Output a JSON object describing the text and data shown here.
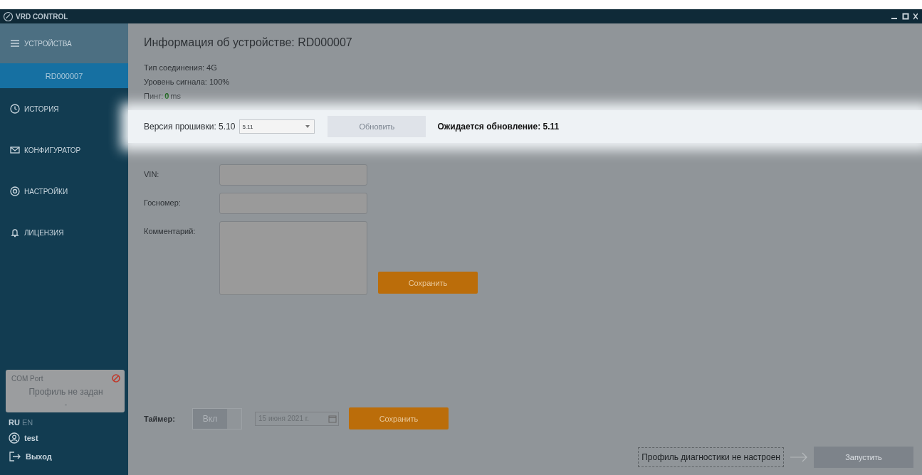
{
  "window": {
    "title": "VRD CONTROL"
  },
  "sidebar": {
    "items": [
      {
        "label": "УСТРОЙСТВА",
        "selected": false,
        "expanded": true,
        "children": [
          {
            "label": "RD000007",
            "selected": true
          }
        ]
      },
      {
        "label": "ИСТОРИЯ",
        "selected": false
      },
      {
        "label": "КОНФИГУРАТОР",
        "selected": false
      },
      {
        "label": "НАСТРОЙКИ",
        "selected": false
      },
      {
        "label": "ЛИЦЕНЗИЯ",
        "selected": false
      }
    ],
    "com_port": {
      "title": "COM Port",
      "profile": "Профиль не задан",
      "value": "-"
    },
    "languages": [
      {
        "label": "RU",
        "selected": true
      },
      {
        "label": "EN",
        "selected": false
      }
    ],
    "user": "test",
    "logout": "Выход"
  },
  "device": {
    "title": "Информация об устройстве: RD000007",
    "info": [
      "Тип соединения: 4G",
      "Уровень сигнала: 100%"
    ],
    "ping": {
      "label": "Пинг:",
      "value": "0",
      "unit": "ms"
    },
    "firmware": {
      "label": "Версия прошивки: 5.10",
      "select": "5.11",
      "button": {
        "label": "Обновить",
        "disabled": true
      },
      "status": "Ожидается обновление: 5.11"
    },
    "fields": [
      {
        "label": "VIN:",
        "kind": "input"
      },
      {
        "label": "Госномер:",
        "kind": "input"
      },
      {
        "label": "Комментарий:",
        "kind": "textarea"
      }
    ],
    "save": "Сохранить",
    "timer": {
      "label": "Таймер:",
      "toggle": {
        "label": "Вкл",
        "on": true
      },
      "date": "15 июня 2021 г.",
      "save": "Сохранить"
    },
    "footer": {
      "note": "Профиль диагностики не настроен",
      "button": {
        "label": "Запустить",
        "disabled": true
      }
    }
  }
}
